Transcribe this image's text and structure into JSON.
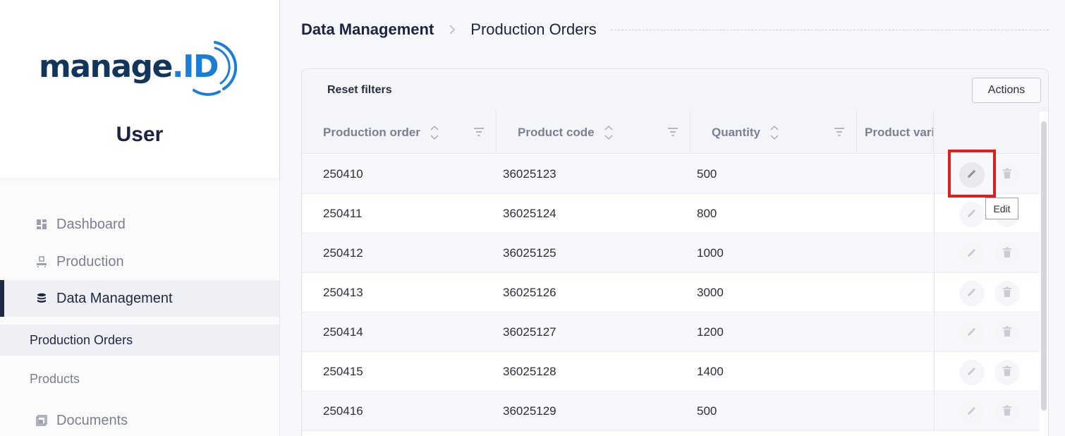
{
  "sidebar": {
    "logo": {
      "text_main": "manage",
      "text_dot": ".",
      "text_id": "ID"
    },
    "user_title": "User",
    "nav": [
      {
        "label": "Dashboard",
        "icon": "dashboard-icon"
      },
      {
        "label": "Production",
        "icon": "production-icon"
      },
      {
        "label": "Data Management",
        "icon": "database-icon",
        "active": true
      }
    ],
    "sub_items": [
      {
        "label": "Production Orders",
        "active": true
      },
      {
        "label": "Products"
      }
    ],
    "nav_bottom": {
      "label": "Documents",
      "icon": "documents-icon"
    }
  },
  "breadcrumb": {
    "root": "Data Management",
    "current": "Production Orders"
  },
  "toolbar": {
    "reset_label": "Reset filters",
    "actions_label": "Actions"
  },
  "table": {
    "columns": [
      "Production order",
      "Product code",
      "Quantity",
      "Product variant"
    ],
    "rows": [
      {
        "order": "250410",
        "code": "36025123",
        "qty": "500"
      },
      {
        "order": "250411",
        "code": "36025124",
        "qty": "800"
      },
      {
        "order": "250412",
        "code": "36025125",
        "qty": "1000"
      },
      {
        "order": "250413",
        "code": "36025126",
        "qty": "3000"
      },
      {
        "order": "250414",
        "code": "36025127",
        "qty": "1200"
      },
      {
        "order": "250415",
        "code": "36025128",
        "qty": "1400"
      },
      {
        "order": "250416",
        "code": "36025129",
        "qty": "500"
      }
    ]
  },
  "tooltip": "Edit",
  "colors": {
    "accent": "#1a7ed6",
    "brand_dark": "#12365b",
    "highlight": "#e01e1e"
  }
}
